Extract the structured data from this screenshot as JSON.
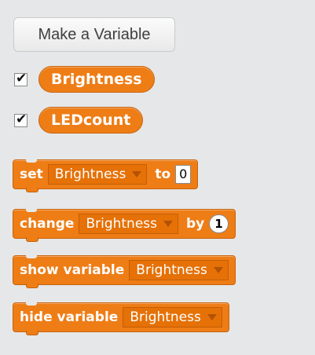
{
  "palette": {
    "make_variable_label": "Make a Variable",
    "variables": [
      {
        "name": "Brightness",
        "checked": true
      },
      {
        "name": "LEDcount",
        "checked": true
      }
    ],
    "checkmark_glyph": "✔",
    "blocks": {
      "set": {
        "keyword": "set",
        "variable": "Brightness",
        "connector": "to",
        "value": "0"
      },
      "change": {
        "keyword": "change",
        "variable": "Brightness",
        "connector": "by",
        "value": "1"
      },
      "show": {
        "keyword": "show variable",
        "variable": "Brightness"
      },
      "hide": {
        "keyword": "hide variable",
        "variable": "Brightness"
      }
    },
    "colors": {
      "block_orange": "#ee7d16",
      "dropdown_orange": "#e57107",
      "background": "#e6e7e8"
    }
  }
}
